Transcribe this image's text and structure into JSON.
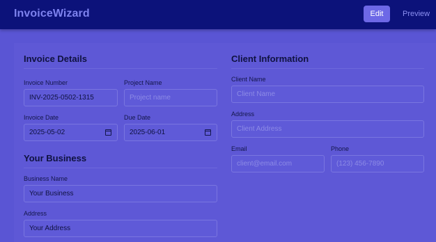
{
  "app": {
    "title": "InvoiceWizard"
  },
  "nav": {
    "edit_label": "Edit",
    "preview_label": "Preview"
  },
  "invoice_details": {
    "heading": "Invoice Details",
    "invoice_number": {
      "label": "Invoice Number",
      "value": "INV-2025-0502-1315"
    },
    "project_name": {
      "label": "Project Name",
      "placeholder": "Project name"
    },
    "invoice_date": {
      "label": "Invoice Date",
      "value": "2025-05-02"
    },
    "due_date": {
      "label": "Due Date",
      "value": "2025-06-01"
    }
  },
  "your_business": {
    "heading": "Your Business",
    "business_name": {
      "label": "Business Name",
      "value": "Your Business"
    },
    "address": {
      "label": "Address",
      "value": "Your Address"
    }
  },
  "client_information": {
    "heading": "Client Information",
    "client_name": {
      "label": "Client Name",
      "placeholder": "Client Name"
    },
    "address": {
      "label": "Address",
      "placeholder": "Client Address"
    },
    "email": {
      "label": "Email",
      "placeholder": "client@email.com"
    },
    "phone": {
      "label": "Phone",
      "placeholder": "(123) 456-7890"
    }
  },
  "colors": {
    "topbar": "#0c127a",
    "page": "#5a55d4",
    "accent": "#6d68e6",
    "brand": "#7d82ee"
  },
  "icons": {
    "date_picker": "calendar-icon"
  }
}
